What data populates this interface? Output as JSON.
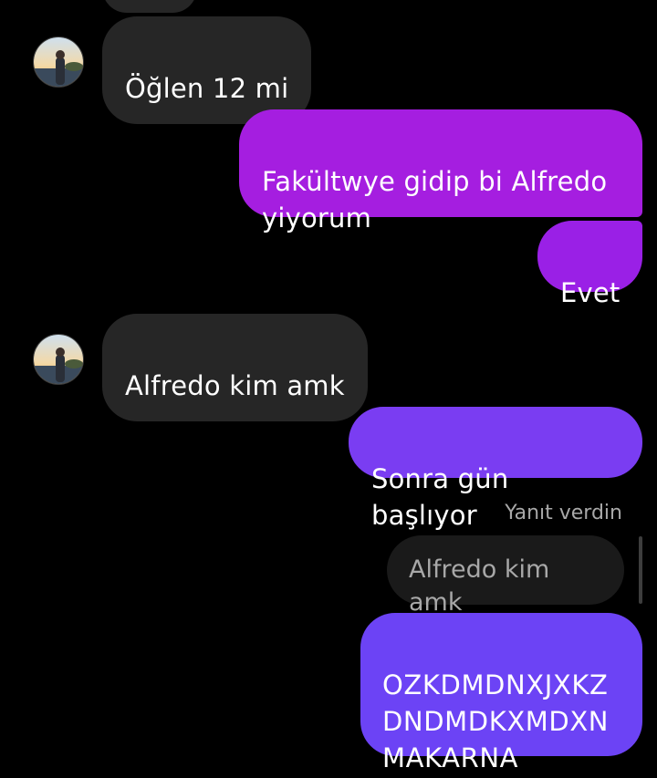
{
  "colors": {
    "background": "#000000",
    "incoming_bubble": "#262626",
    "outgoing_magenta": "#a51ee0",
    "outgoing_purple": "#7a3df2",
    "outgoing_violet": "#6c43f5",
    "reply_quote": "#1a1a1a",
    "muted_text": "#a8a8a8"
  },
  "avatar": {
    "icon": "profile-photo-icon"
  },
  "messages": [
    {
      "direction": "incoming",
      "text": "Öğlen 12 mi"
    },
    {
      "direction": "outgoing",
      "text": "Fakültwye gidip bi Alfredo\nyiyorum"
    },
    {
      "direction": "outgoing",
      "text": "Evet"
    },
    {
      "direction": "incoming",
      "text": "Alfredo kim amk"
    },
    {
      "direction": "outgoing",
      "text": "Sonra gün başlıyor"
    },
    {
      "direction": "outgoing",
      "reply_label": "Yanıt verdin",
      "quoted_text": "Alfredo kim amk",
      "text": "OZKDMDNXJXKZ\nDNDMDKXMDXN\nMAKARNA"
    }
  ]
}
